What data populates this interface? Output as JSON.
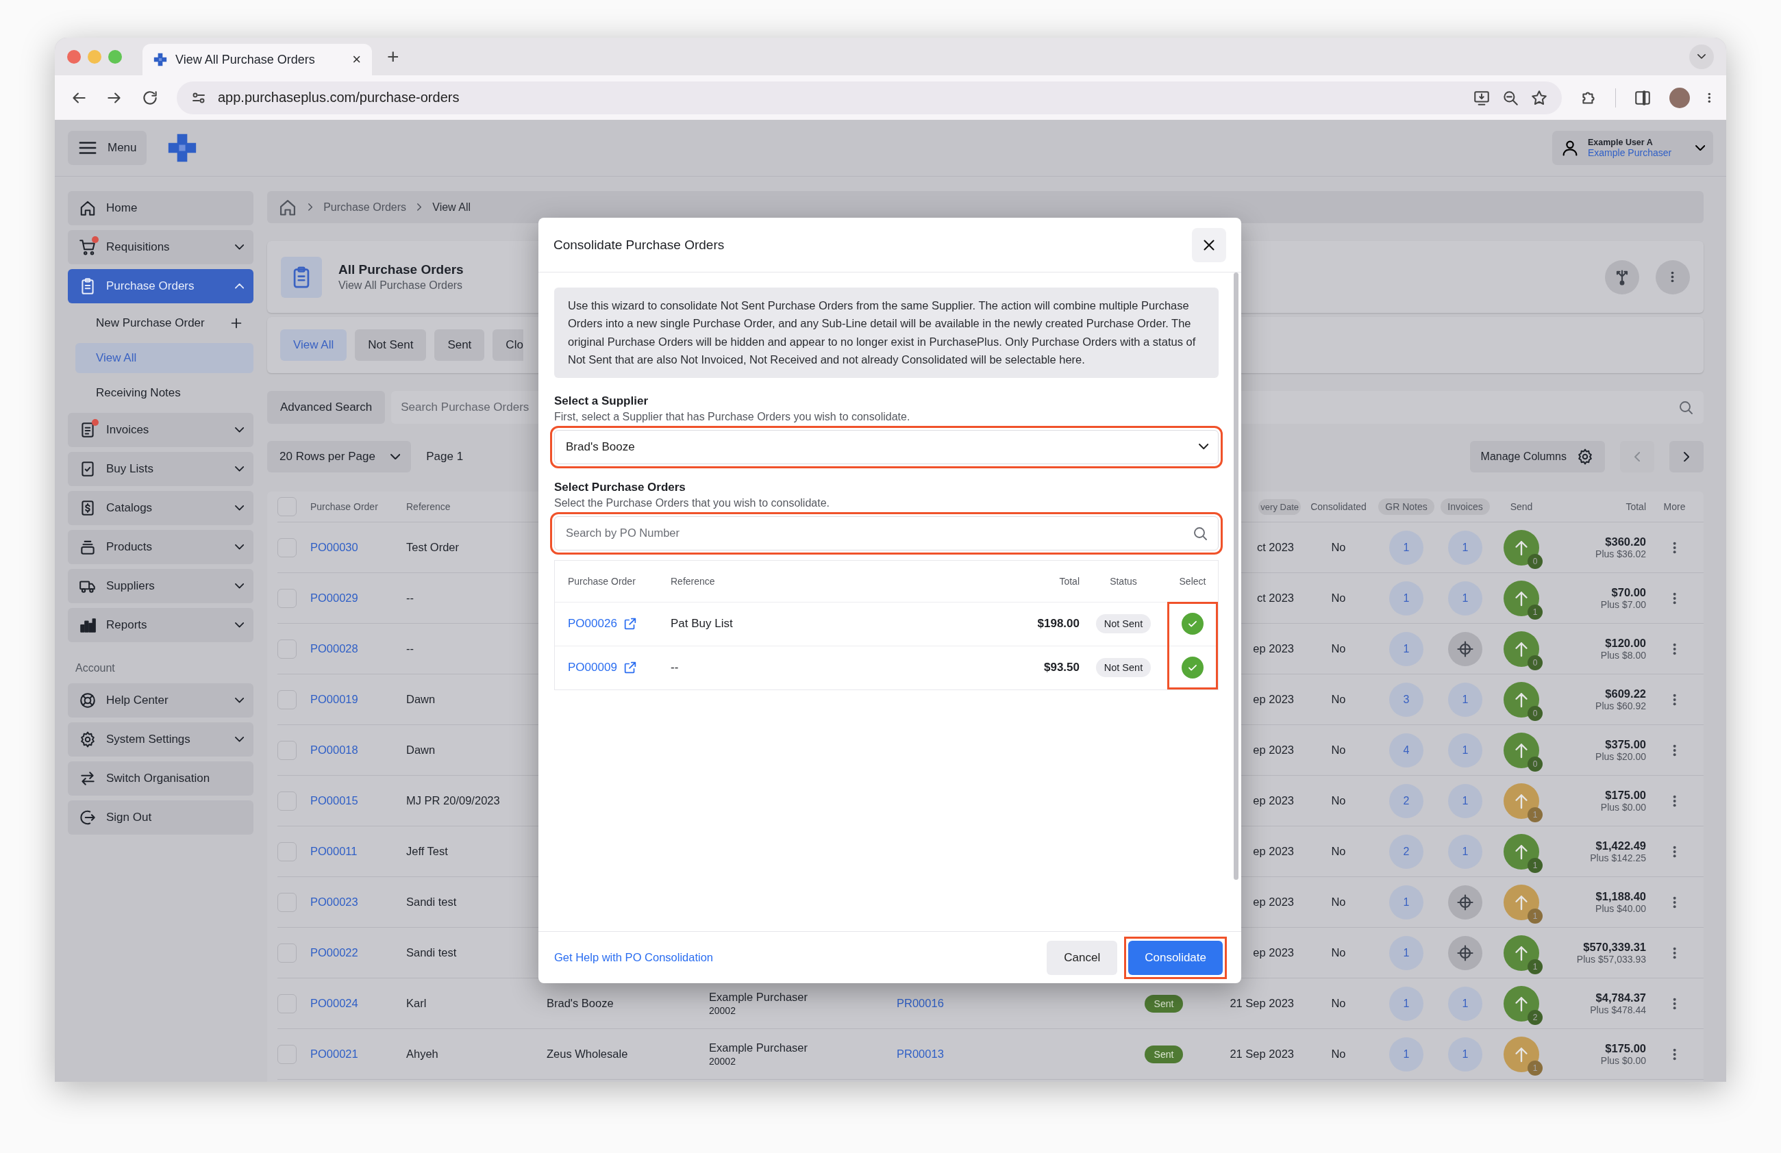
{
  "browser": {
    "tab_title": "View All Purchase Orders",
    "tab_close": "×",
    "new_tab": "+",
    "url": "app.purchaseplus.com/purchase-orders"
  },
  "header": {
    "menu_label": "Menu",
    "user_name": "Example User A",
    "user_role": "Example Purchaser"
  },
  "sidebar": {
    "items": [
      {
        "label": "Home",
        "selected": false,
        "notification": false
      },
      {
        "label": "Requisitions",
        "selected": false,
        "notification": true,
        "expanded": false
      },
      {
        "label": "Purchase Orders",
        "selected": true,
        "notification": false,
        "expanded": true,
        "children": [
          {
            "label": "New Purchase Order",
            "kind": "add",
            "selected": false
          },
          {
            "label": "View All",
            "kind": "link",
            "selected": true
          },
          {
            "label": "Receiving Notes",
            "kind": "link",
            "selected": false
          }
        ]
      },
      {
        "label": "Invoices",
        "selected": false,
        "notification": true,
        "expanded": false
      },
      {
        "label": "Buy Lists",
        "selected": false,
        "notification": false,
        "expanded": false
      },
      {
        "label": "Catalogs",
        "selected": false,
        "notification": false,
        "expanded": false
      },
      {
        "label": "Products",
        "selected": false,
        "notification": false,
        "expanded": false
      },
      {
        "label": "Suppliers",
        "selected": false,
        "notification": false,
        "expanded": false
      },
      {
        "label": "Reports",
        "selected": false,
        "notification": false,
        "expanded": false
      }
    ],
    "account": {
      "heading": "Account",
      "items": [
        {
          "label": "Help Center",
          "expanded": false
        },
        {
          "label": "System Settings",
          "expanded": false
        },
        {
          "label": "Switch Organisation"
        },
        {
          "label": "Sign Out"
        }
      ]
    }
  },
  "breadcrumb": [
    "Purchase Orders",
    "View All"
  ],
  "page_header": {
    "title": "All Purchase Orders",
    "subtitle": "View All Purchase Orders"
  },
  "tabs": [
    {
      "label": "View All",
      "selected": true
    },
    {
      "label": "Not Sent",
      "selected": false
    },
    {
      "label": "Sent",
      "selected": false
    },
    {
      "label": "Clo",
      "selected": false
    }
  ],
  "search": {
    "button": "Advanced Search",
    "placeholder": "Search Purchase Orders"
  },
  "pagination": {
    "rows_per_page": "20 Rows per Page",
    "page": "Page 1",
    "manage_columns": "Manage Columns"
  },
  "table": {
    "select_all_checked": false,
    "header": {
      "purchase_order": {
        "label": "Purchase Order",
        "pill": false
      },
      "reference": {
        "label": "Reference",
        "pill": false
      },
      "delivery_date": {
        "label": "very Date",
        "pill": true
      },
      "consolidated": {
        "label": "Consolidated",
        "pill": false
      },
      "gr_notes": {
        "label": "GR Notes",
        "pill": true
      },
      "invoices": {
        "label": "Invoices",
        "pill": true
      },
      "send": {
        "label": "Send",
        "pill": false
      },
      "total": {
        "label": "Total",
        "pill": false
      },
      "more": {
        "label": "More",
        "pill": false
      }
    },
    "rows": [
      {
        "checked": false,
        "purchase_order": "PO00030",
        "reference": "Test Order",
        "delivery_date": "ct 2023",
        "consolidated": "No",
        "gr_notes": "1",
        "invoices": {
          "kind": "count",
          "value": "1"
        },
        "send": {
          "color": "#5a8a3c",
          "count": "0"
        },
        "total": "$360.20",
        "tax": "Plus $36.02"
      },
      {
        "checked": false,
        "purchase_order": "PO00029",
        "reference": "--",
        "delivery_date": "ct 2023",
        "consolidated": "No",
        "gr_notes": "1",
        "invoices": {
          "kind": "count",
          "value": "1"
        },
        "send": {
          "color": "#5a8a3c",
          "count": "1"
        },
        "total": "$70.00",
        "tax": "Plus $7.00"
      },
      {
        "checked": false,
        "purchase_order": "PO00028",
        "reference": "--",
        "delivery_date": "ep 2023",
        "consolidated": "No",
        "gr_notes": "1",
        "invoices": {
          "kind": "target"
        },
        "send": {
          "color": "#5a8a3c",
          "count": "0"
        },
        "total": "$120.00",
        "tax": "Plus $8.00"
      },
      {
        "checked": false,
        "purchase_order": "PO00019",
        "reference": "Dawn",
        "delivery_date": "ep 2023",
        "consolidated": "No",
        "gr_notes": "3",
        "invoices": {
          "kind": "count",
          "value": "1"
        },
        "send": {
          "color": "#5a8a3c",
          "count": "0"
        },
        "total": "$609.22",
        "tax": "Plus $60.92"
      },
      {
        "checked": false,
        "purchase_order": "PO00018",
        "reference": "Dawn",
        "delivery_date": "ep 2023",
        "consolidated": "No",
        "gr_notes": "4",
        "invoices": {
          "kind": "count",
          "value": "1"
        },
        "send": {
          "color": "#5a8a3c",
          "count": "0"
        },
        "total": "$375.00",
        "tax": "Plus $20.00"
      },
      {
        "checked": false,
        "purchase_order": "PO00015",
        "reference": "MJ PR 20/09/2023",
        "delivery_date": "ep 2023",
        "consolidated": "No",
        "gr_notes": "2",
        "invoices": {
          "kind": "count",
          "value": "1"
        },
        "send": {
          "color": "#c09a55",
          "count": "1"
        },
        "total": "$175.00",
        "tax": "Plus $0.00"
      },
      {
        "checked": false,
        "purchase_order": "PO00011",
        "reference": "Jeff Test",
        "delivery_date": "ep 2023",
        "consolidated": "No",
        "gr_notes": "2",
        "invoices": {
          "kind": "count",
          "value": "1"
        },
        "send": {
          "color": "#5a8a3c",
          "count": "1"
        },
        "total": "$1,422.49",
        "tax": "Plus $142.25"
      },
      {
        "checked": false,
        "purchase_order": "PO00023",
        "reference": "Sandi test",
        "delivery_date": "ep 2023",
        "consolidated": "No",
        "gr_notes": "1",
        "invoices": {
          "kind": "target"
        },
        "send": {
          "color": "#c09a55",
          "count": "1"
        },
        "total": "$1,188.40",
        "tax": "Plus $40.00"
      },
      {
        "checked": false,
        "purchase_order": "PO00022",
        "reference": "Sandi test",
        "delivery_date": "ep 2023",
        "consolidated": "No",
        "gr_notes": "1",
        "invoices": {
          "kind": "target"
        },
        "send": {
          "color": "#5a8a3c",
          "count": "1"
        },
        "total": "$570,339.31",
        "tax": "Plus $57,033.93"
      },
      {
        "checked": false,
        "purchase_order": "PO00024",
        "reference": "Karl",
        "supplier": "Brad's Booze",
        "requestor": "Example Purchaser",
        "requestor_id": "20002",
        "requisition": "PR00016",
        "status": "Sent",
        "delivery_date": "21 Sep 2023",
        "consolidated": "No",
        "gr_notes": "1",
        "invoices": {
          "kind": "count",
          "value": "1"
        },
        "send": {
          "color": "#5a8a3c",
          "count": "2"
        },
        "total": "$4,784.37",
        "tax": "Plus $478.44"
      },
      {
        "checked": false,
        "purchase_order": "PO00021",
        "reference": "Ahyeh",
        "supplier": "Zeus Wholesale",
        "requestor": "Example Purchaser",
        "requestor_id": "20002",
        "requisition": "PR00013",
        "status": "Sent",
        "delivery_date": "21 Sep 2023",
        "consolidated": "No",
        "gr_notes": "1",
        "invoices": {
          "kind": "count",
          "value": "1"
        },
        "send": {
          "color": "#c09a55",
          "count": "1"
        },
        "total": "$175.00",
        "tax": "Plus $0.00"
      }
    ]
  },
  "modal": {
    "title": "Consolidate Purchase Orders",
    "intro": "Use this wizard to consolidate Not Sent Purchase Orders from the same Supplier. The action will combine multiple Purchase Orders into a new single Purchase Order, and any Sub-Line detail will be available in the newly created Purchase Order. The original Purchase Orders will be hidden and appear to no longer exist in PurchasePlus. Only Purchase Orders with a status of Not Sent that are also Not Invoiced, Not Received and not already Consolidated will be selectable here.",
    "supplier": {
      "label": "Select a Supplier",
      "help": "First, select a Supplier that has Purchase Orders you wish to consolidate.",
      "value": "Brad's Booze",
      "highlighted": true
    },
    "orders": {
      "label": "Select Purchase Orders",
      "help": "Select the Purchase Orders that you wish to consolidate.",
      "placeholder": "Search by PO Number",
      "search_highlighted": true,
      "select_highlighted": true,
      "columns": [
        "Purchase Order",
        "Reference",
        "Total",
        "Status",
        "Select"
      ],
      "rows": [
        {
          "purchase_order": "PO00026",
          "reference": "Pat Buy List",
          "total": "$198.00",
          "status": "Not Sent",
          "selected": true
        },
        {
          "purchase_order": "PO00009",
          "reference": "--",
          "total": "$93.50",
          "status": "Not Sent",
          "selected": true
        }
      ]
    },
    "help_link": "Get Help with PO Consolidation",
    "cancel": "Cancel",
    "confirm": {
      "label": "Consolidate",
      "highlighted": true
    }
  }
}
